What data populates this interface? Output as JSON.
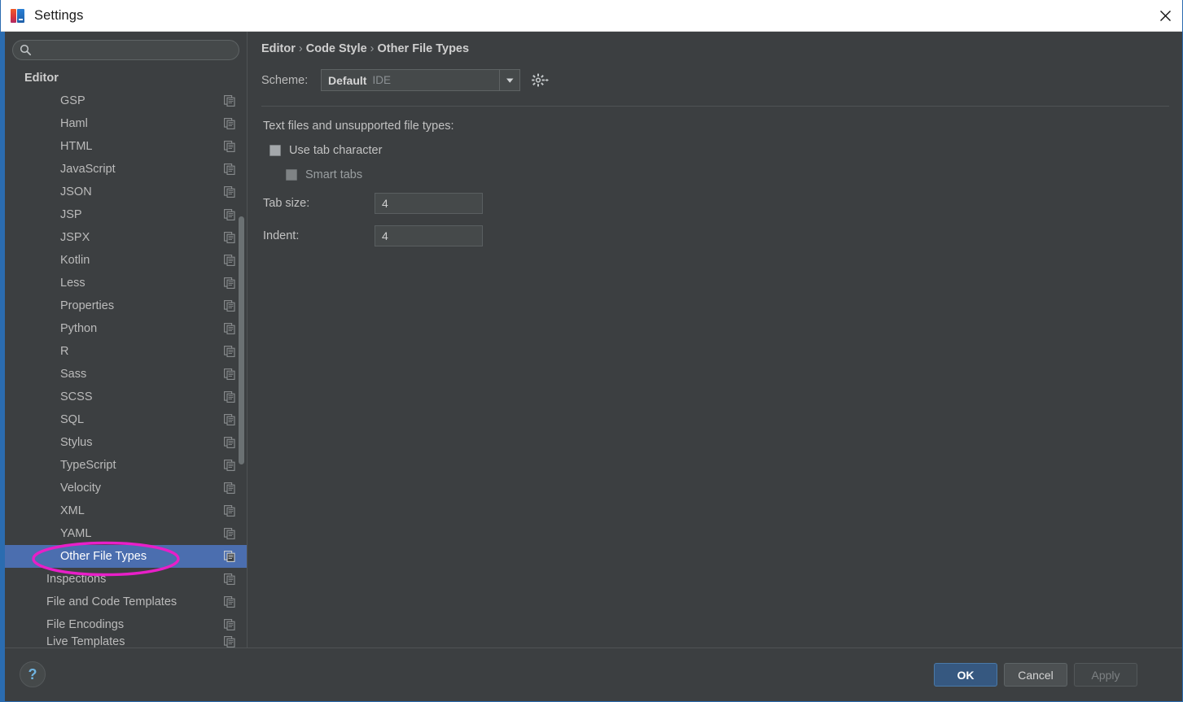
{
  "window": {
    "title": "Settings",
    "app_icon": "intellij-idea-icon",
    "close_icon": "close-icon"
  },
  "search": {
    "placeholder": "",
    "value": "",
    "icon": "search-icon"
  },
  "sidebar": {
    "items": [
      {
        "label": "Editor",
        "indent": 0,
        "group": true,
        "selected": false,
        "icon": ""
      },
      {
        "label": "GSP",
        "indent": 2,
        "group": false,
        "selected": false,
        "icon": "copy-scheme-icon"
      },
      {
        "label": "Haml",
        "indent": 2,
        "group": false,
        "selected": false,
        "icon": "copy-scheme-icon"
      },
      {
        "label": "HTML",
        "indent": 2,
        "group": false,
        "selected": false,
        "icon": "copy-scheme-icon"
      },
      {
        "label": "JavaScript",
        "indent": 2,
        "group": false,
        "selected": false,
        "icon": "copy-scheme-icon"
      },
      {
        "label": "JSON",
        "indent": 2,
        "group": false,
        "selected": false,
        "icon": "copy-scheme-icon"
      },
      {
        "label": "JSP",
        "indent": 2,
        "group": false,
        "selected": false,
        "icon": "copy-scheme-icon"
      },
      {
        "label": "JSPX",
        "indent": 2,
        "group": false,
        "selected": false,
        "icon": "copy-scheme-icon"
      },
      {
        "label": "Kotlin",
        "indent": 2,
        "group": false,
        "selected": false,
        "icon": "copy-scheme-icon"
      },
      {
        "label": "Less",
        "indent": 2,
        "group": false,
        "selected": false,
        "icon": "copy-scheme-icon"
      },
      {
        "label": "Properties",
        "indent": 2,
        "group": false,
        "selected": false,
        "icon": "copy-scheme-icon"
      },
      {
        "label": "Python",
        "indent": 2,
        "group": false,
        "selected": false,
        "icon": "copy-scheme-icon"
      },
      {
        "label": "R",
        "indent": 2,
        "group": false,
        "selected": false,
        "icon": "copy-scheme-icon"
      },
      {
        "label": "Sass",
        "indent": 2,
        "group": false,
        "selected": false,
        "icon": "copy-scheme-icon"
      },
      {
        "label": "SCSS",
        "indent": 2,
        "group": false,
        "selected": false,
        "icon": "copy-scheme-icon"
      },
      {
        "label": "SQL",
        "indent": 2,
        "group": false,
        "selected": false,
        "icon": "copy-scheme-icon"
      },
      {
        "label": "Stylus",
        "indent": 2,
        "group": false,
        "selected": false,
        "icon": "copy-scheme-icon"
      },
      {
        "label": "TypeScript",
        "indent": 2,
        "group": false,
        "selected": false,
        "icon": "copy-scheme-icon"
      },
      {
        "label": "Velocity",
        "indent": 2,
        "group": false,
        "selected": false,
        "icon": "copy-scheme-icon"
      },
      {
        "label": "XML",
        "indent": 2,
        "group": false,
        "selected": false,
        "icon": "copy-scheme-icon"
      },
      {
        "label": "YAML",
        "indent": 2,
        "group": false,
        "selected": false,
        "icon": "copy-scheme-icon"
      },
      {
        "label": "Other File Types",
        "indent": 2,
        "group": false,
        "selected": true,
        "icon": "copy-scheme-icon"
      },
      {
        "label": "Inspections",
        "indent": 1,
        "group": false,
        "selected": false,
        "icon": "copy-scheme-icon"
      },
      {
        "label": "File and Code Templates",
        "indent": 1,
        "group": false,
        "selected": false,
        "icon": "copy-scheme-icon"
      },
      {
        "label": "File Encodings",
        "indent": 1,
        "group": false,
        "selected": false,
        "icon": "copy-scheme-icon"
      },
      {
        "label": "Live Templates",
        "indent": 1,
        "group": false,
        "selected": false,
        "icon": "copy-scheme-icon"
      }
    ]
  },
  "main": {
    "breadcrumb": [
      "Editor",
      "Code Style",
      "Other File Types"
    ],
    "breadcrumb_separator": "›",
    "scheme": {
      "label": "Scheme:",
      "value": "Default",
      "scope": "IDE",
      "arrow_icon": "chevron-down-icon",
      "gear_icon": "gear-icon"
    },
    "section_title": "Text files and unsupported file types:",
    "checkboxes": [
      {
        "label": "Use tab character",
        "checked": false,
        "disabled": false
      },
      {
        "label": "Smart tabs",
        "checked": false,
        "disabled": true
      }
    ],
    "fields": [
      {
        "label": "Tab size:",
        "value": "4"
      },
      {
        "label": "Indent:",
        "value": "4"
      }
    ]
  },
  "footer": {
    "help_label": "?",
    "help_icon": "help-icon",
    "buttons": [
      {
        "label": "OK",
        "style": "primary"
      },
      {
        "label": "Cancel",
        "style": "normal"
      },
      {
        "label": "Apply",
        "style": "disabled"
      }
    ]
  },
  "annotation": {
    "shape": "ellipse",
    "color": "#e81fc8",
    "target": "Other File Types"
  }
}
